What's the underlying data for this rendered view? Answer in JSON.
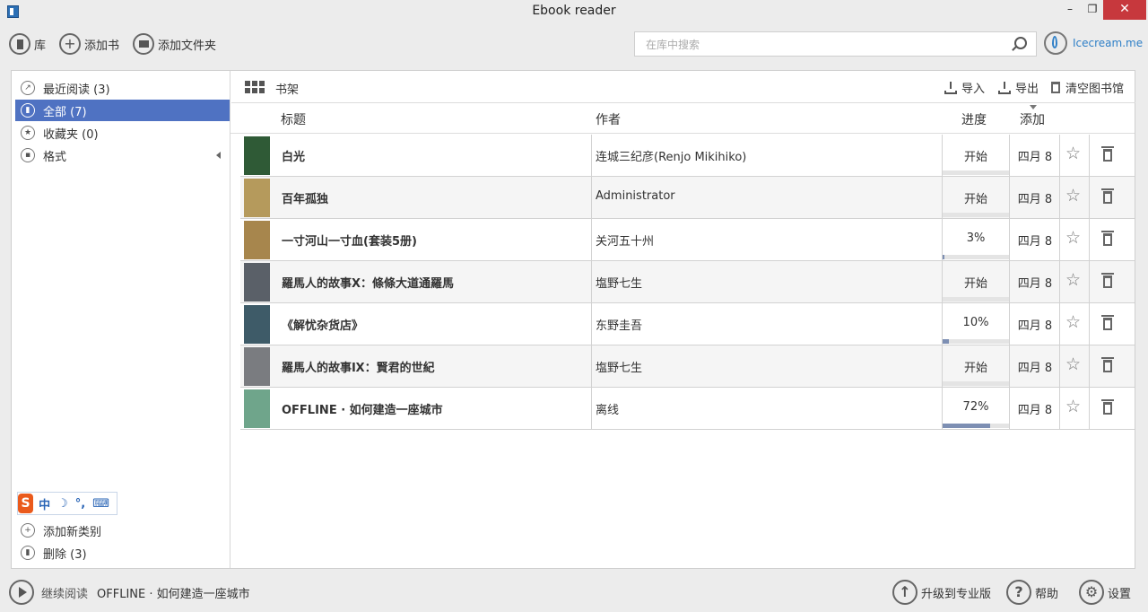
{
  "window": {
    "title": "Ebook reader",
    "min_label": "–",
    "max_label": "❐",
    "close_label": "✕"
  },
  "toolbar": {
    "library_label": "库",
    "add_book_label": "添加书",
    "add_folder_label": "添加文件夹",
    "search_placeholder": "在库中搜索",
    "brand": "Icecream.me"
  },
  "sidebar": {
    "items": [
      {
        "label": "最近阅读 (3)",
        "icon": "recent-icon"
      },
      {
        "label": "全部 (7)",
        "icon": "book-icon",
        "active": true
      },
      {
        "label": "收藏夹 (0)",
        "icon": "star-icon"
      },
      {
        "label": "格式",
        "icon": "file-icon"
      }
    ],
    "add_category_label": "添加新类别",
    "delete_label": "删除 (3)",
    "ime": {
      "logo": "S",
      "chars": [
        "中",
        "☽",
        "°,",
        "⌨"
      ]
    }
  },
  "shelf": {
    "title": "书架",
    "import_label": "导入",
    "export_label": "导出",
    "clear_label": "清空图书馆"
  },
  "table": {
    "headers": {
      "title": "标题",
      "author": "作者",
      "progress": "进度",
      "added": "添加"
    },
    "rows": [
      {
        "title": "白光",
        "author": "连城三纪彦(Renjo Mikihiko)",
        "progress": "开始",
        "progress_value": 0,
        "date": "四月 8",
        "cover": "#2f5a36"
      },
      {
        "title": "百年孤独",
        "author": "Administrator",
        "progress": "开始",
        "progress_value": 0,
        "date": "四月 8",
        "cover": "#b59a5c"
      },
      {
        "title": "一寸河山一寸血(套装5册)",
        "author": "关河五十州",
        "progress": "3%",
        "progress_value": 0.03,
        "date": "四月 8",
        "cover": "#a7864d"
      },
      {
        "title": "羅馬人的故事Ⅹ：條條大道通羅馬",
        "author": "塩野七生",
        "progress": "开始",
        "progress_value": 0,
        "date": "四月 8",
        "cover": "#5a6068"
      },
      {
        "title": "《解忧杂货店》",
        "author": "东野圭吾",
        "progress": "10%",
        "progress_value": 0.1,
        "date": "四月 8",
        "cover": "#3e5b68"
      },
      {
        "title": "羅馬人的故事Ⅸ：賢君的世紀",
        "author": "塩野七生",
        "progress": "开始",
        "progress_value": 0,
        "date": "四月 8",
        "cover": "#7a7c80"
      },
      {
        "title": "OFFLINE · 如何建造一座城市",
        "author": "离线",
        "progress": "72%",
        "progress_value": 0.72,
        "date": "四月 8",
        "cover": "#6fa58b"
      }
    ]
  },
  "status": {
    "continue_label": "继续阅读",
    "current_book": "OFFLINE · 如何建造一座城市",
    "upgrade_label": "升级到专业版",
    "help_label": "帮助",
    "settings_label": "设置"
  }
}
